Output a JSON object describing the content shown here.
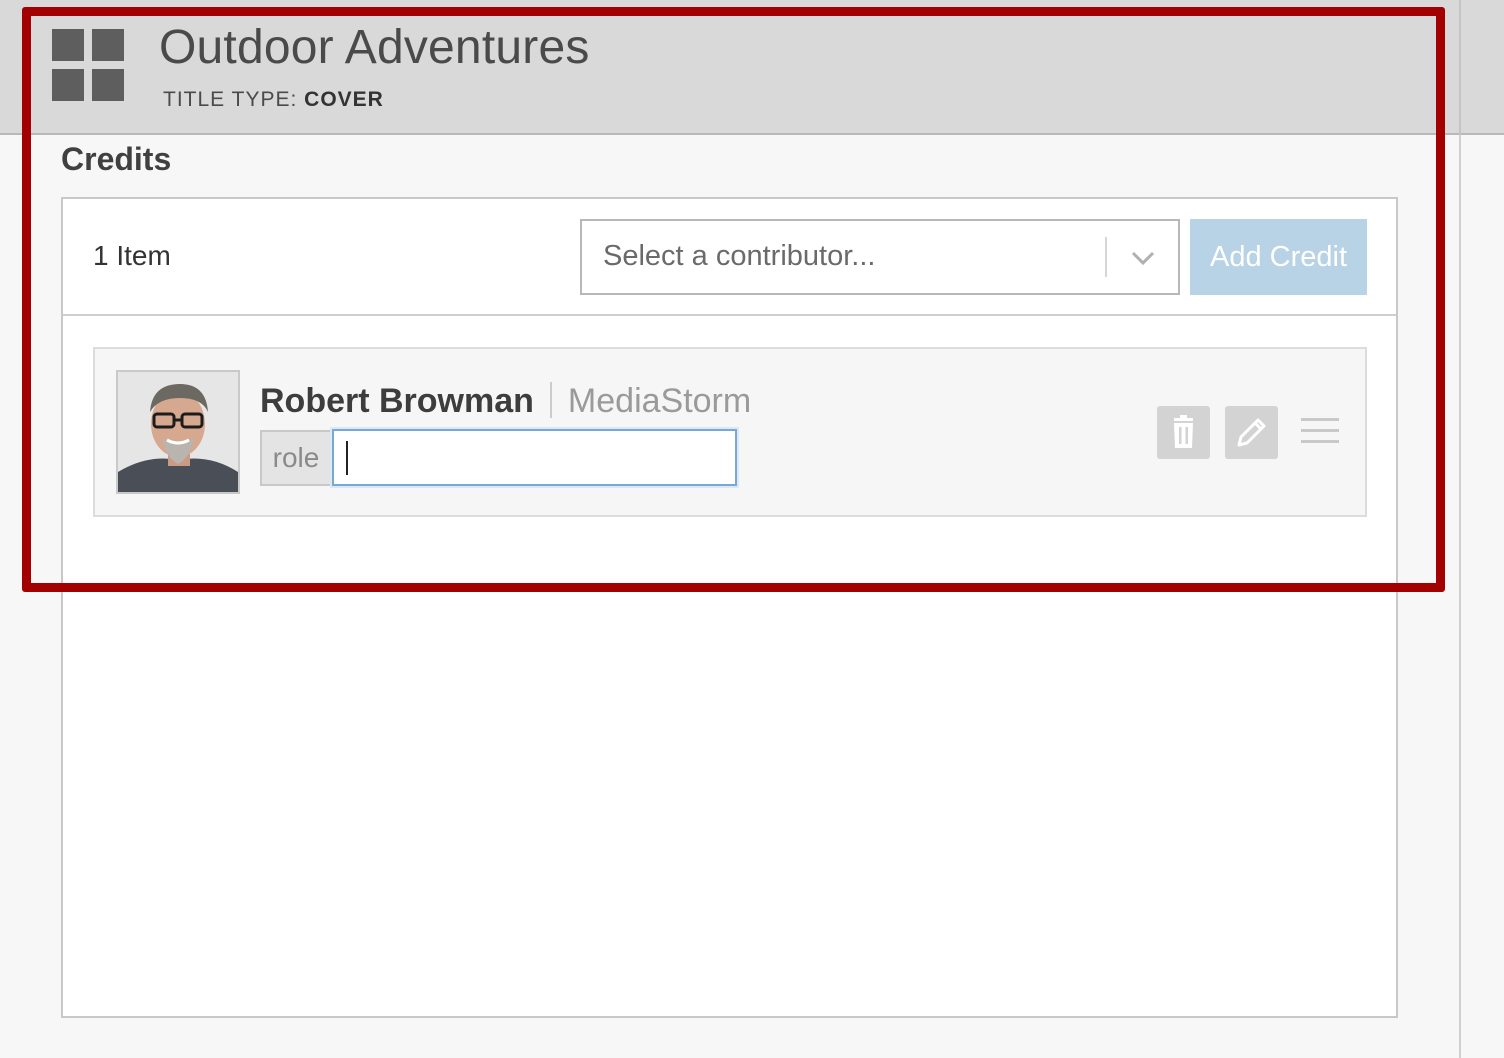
{
  "header": {
    "title": "Outdoor Adventures",
    "title_type_label": "TITLE TYPE:",
    "title_type_value": "COVER",
    "icon": "grid-icon"
  },
  "credits": {
    "section_title": "Credits",
    "item_count": "1 Item",
    "contributor_select": {
      "placeholder": "Select a contributor...",
      "icon": "chevron-down-icon"
    },
    "add_credit_label": "Add Credit",
    "items": [
      {
        "name": "Robert Browman",
        "organization": "MediaStorm",
        "role_label": "role",
        "role_value": "",
        "actions": [
          "trash-icon",
          "pencil-icon",
          "drag-handle-icon"
        ]
      }
    ]
  },
  "colors": {
    "highlight_border": "#a30000",
    "add_credit_bg": "#b8d2e6",
    "header_bg": "#d9d9d9",
    "focus_border": "#7aa7d6"
  }
}
